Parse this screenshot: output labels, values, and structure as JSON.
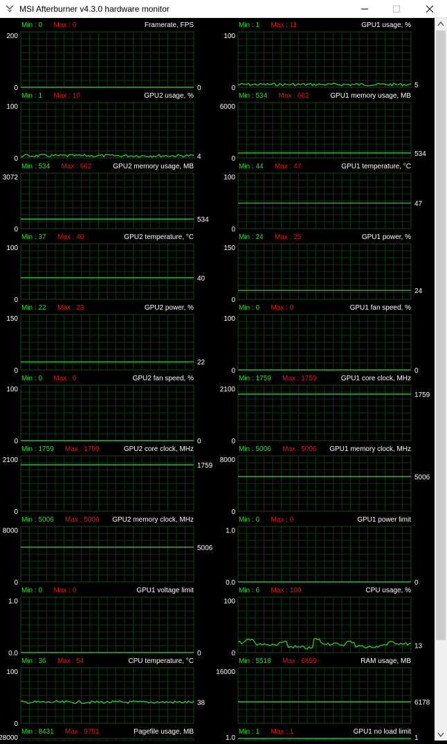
{
  "window": {
    "title": "MSI Afterburner v4.3.0 hardware monitor"
  },
  "colors": {
    "line": "#39d939",
    "grid": "#0a3a0a",
    "label_min": "#39d939",
    "label_max": "#d42020",
    "text": "#ffffff"
  },
  "graphs": [
    {
      "title": "Framerate, FPS",
      "min_label": "Min : 0",
      "max_label": "Max : 0",
      "top": "200",
      "bottom": "0",
      "current": "0",
      "level": 0.0,
      "noise": 0
    },
    {
      "title": "GPU1 usage, %",
      "min_label": "Min : 1",
      "max_label": "Max : 11",
      "top": "100",
      "bottom": "0",
      "current": "5",
      "level": 0.05,
      "noise": 1
    },
    {
      "title": "GPU2 usage, %",
      "min_label": "Min : 1",
      "max_label": "Max : 10",
      "top": "100",
      "bottom": "0",
      "current": "4",
      "level": 0.04,
      "noise": 1
    },
    {
      "title": "GPU1 memory usage, MB",
      "min_label": "Min : 534",
      "max_label": "Max : 662",
      "top": "6000",
      "bottom": "0",
      "current": "534",
      "level": 0.089,
      "noise": 0
    },
    {
      "title": "GPU2 memory usage, MB",
      "min_label": "Min : 534",
      "max_label": "Max : 662",
      "top": "3072",
      "bottom": "0",
      "current": "534",
      "level": 0.174,
      "noise": 0
    },
    {
      "title": "GPU1 temperature, °C",
      "min_label": "Min : 44",
      "max_label": "Max : 47",
      "top": "100",
      "bottom": "0",
      "current": "47",
      "level": 0.46,
      "noise": 0
    },
    {
      "title": "GPU2 temperature, °C",
      "min_label": "Min : 37",
      "max_label": "Max : 40",
      "top": "100",
      "bottom": "0",
      "current": "40",
      "level": 0.39,
      "noise": 0
    },
    {
      "title": "GPU1 power, %",
      "min_label": "Min : 24",
      "max_label": "Max : 25",
      "top": "150",
      "bottom": "0",
      "current": "24",
      "level": 0.16,
      "noise": 0
    },
    {
      "title": "GPU2 power, %",
      "min_label": "Min : 22",
      "max_label": "Max : 23",
      "top": "150",
      "bottom": "0",
      "current": "22",
      "level": 0.147,
      "noise": 0
    },
    {
      "title": "GPU1 fan speed, %",
      "min_label": "Min : 0",
      "max_label": "Max : 0",
      "top": "100",
      "bottom": "0",
      "current": "0",
      "level": 0.0,
      "noise": 0
    },
    {
      "title": "GPU2 fan speed, %",
      "min_label": "Min : 0",
      "max_label": "Max : 0",
      "top": "100",
      "bottom": "0",
      "current": "0",
      "level": 0.0,
      "noise": 0
    },
    {
      "title": "GPU1 core clock, MHz",
      "min_label": "Min : 1759",
      "max_label": "Max : 1759",
      "top": "2100",
      "bottom": "0",
      "current": "1759",
      "level": 0.838,
      "noise": 0
    },
    {
      "title": "GPU2 core clock, MHz",
      "min_label": "Min : 1759",
      "max_label": "Max : 1759",
      "top": "2100",
      "bottom": "0",
      "current": "1759",
      "level": 0.838,
      "noise": 0
    },
    {
      "title": "GPU1 memory clock, MHz",
      "min_label": "Min : 5006",
      "max_label": "Max : 5006",
      "top": "8000",
      "bottom": "0",
      "current": "5006",
      "level": 0.626,
      "noise": 0
    },
    {
      "title": "GPU2 memory clock, MHz",
      "min_label": "Min : 5006",
      "max_label": "Max : 5006",
      "top": "8000",
      "bottom": "0",
      "current": "5006",
      "level": 0.626,
      "noise": 0
    },
    {
      "title": "GPU1 power limit",
      "min_label": "Min : 0",
      "max_label": "Max : 0",
      "top": "1.0",
      "bottom": "0.0",
      "current": "0",
      "level": 0.0,
      "noise": 0
    },
    {
      "title": "GPU1 voltage limit",
      "min_label": "Min : 0",
      "max_label": "Max : 0",
      "top": "1.0",
      "bottom": "0.0",
      "current": "0",
      "level": 0.0,
      "noise": 0
    },
    {
      "title": "CPU usage, %",
      "min_label": "Min : 6",
      "max_label": "Max : 100",
      "top": "100",
      "bottom": "0",
      "current": "13",
      "level": 0.13,
      "noise": 2
    },
    {
      "title": "CPU temperature, °C",
      "min_label": "Min : 36",
      "max_label": "Max : 54",
      "top": "100",
      "bottom": "0",
      "current": "38",
      "level": 0.38,
      "noise": 1
    },
    {
      "title": "RAM usage, MB",
      "min_label": "Min : 5518",
      "max_label": "Max : 6859",
      "top": "16000",
      "bottom": "",
      "current": "6178",
      "level": 0.386,
      "noise": 0
    },
    {
      "title": "Pagefile usage, MB",
      "min_label": "Min : 8431",
      "max_label": "Max : 9751",
      "top": "28000",
      "bottom": "",
      "current": "",
      "level": null,
      "noise": 0
    },
    {
      "title": "GPU1 no load limit",
      "min_label": "Min : 1",
      "max_label": "Max : 1",
      "top": "1.0",
      "bottom": "",
      "current": "1",
      "level": 1.0,
      "noise": 0
    }
  ]
}
